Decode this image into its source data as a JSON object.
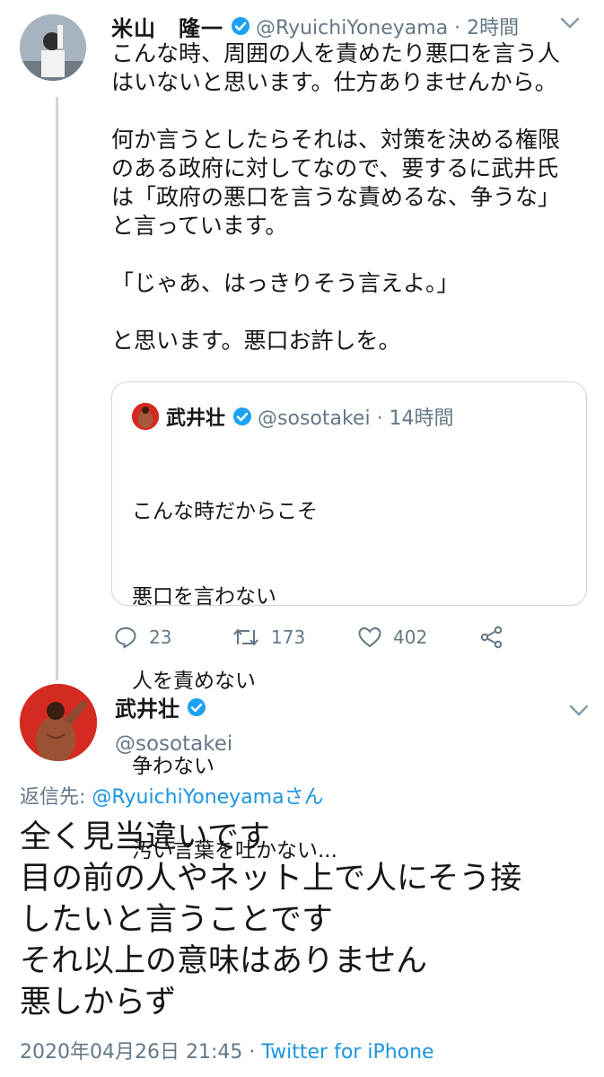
{
  "tweet1": {
    "name": "米山　隆一",
    "handle_time": "@RyuichiYoneyama · 2時間",
    "body_lines": [
      "こんな時、周囲の人を責めたり悪口を言う人",
      "はいないと思います。仕方ありませんから。",
      "",
      "何か言うとしたらそれは、対策を決める権限",
      "のある政府に対してなので、要するに武井氏",
      "は「政府の悪口を言うな責めるな、争うな」",
      "と言っています。",
      "",
      "「じゃあ、はっきりそう言えよ。」",
      "",
      "と思います。悪口お許しを。"
    ],
    "quote": {
      "name": "武井壮",
      "handle_time": "@sosotakei · 14時間",
      "body_lines": [
        "こんな時だからこそ",
        "悪口を言わない",
        "人を責めない",
        "争わない",
        "汚い言葉を吐かない..."
      ]
    },
    "actions": {
      "reply_count": "23",
      "retweet_count": "173",
      "like_count": "402"
    }
  },
  "tweet2": {
    "name": "武井壮",
    "handle": "@sosotakei",
    "reply_prefix": "返信先: ",
    "reply_mention": "@RyuichiYoneyamaさん",
    "body_lines": [
      "全く見当違いです",
      "目の前の人やネット上で人にそう接",
      "したいと言うことです",
      "それ以上の意味はありません",
      "悪しからず"
    ],
    "timestamp": "2020年04月26日 21:45 · ",
    "source": "Twitter for iPhone"
  },
  "colors": {
    "verified": "#1da1f2",
    "link": "#1b95e0",
    "muted": "#657786",
    "border": "#ccd6dd"
  },
  "icons": [
    "verified-badge-icon",
    "chevron-down-icon",
    "reply-icon",
    "retweet-icon",
    "like-icon",
    "share-icon"
  ]
}
